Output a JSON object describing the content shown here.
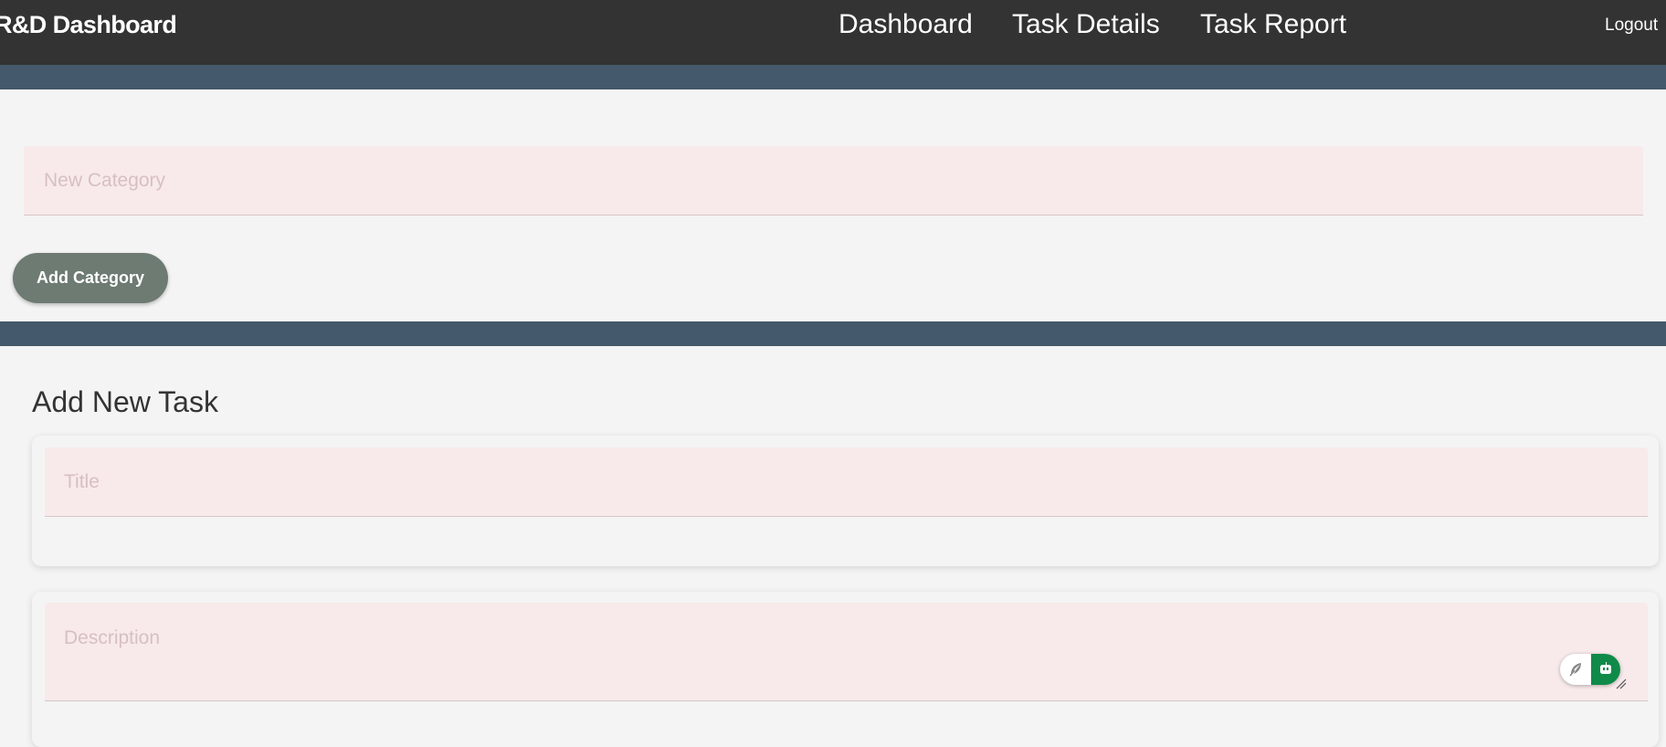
{
  "header": {
    "brand": "R&D Dashboard",
    "nav": {
      "dashboard": "Dashboard",
      "task_details": "Task Details",
      "task_report": "Task Report"
    },
    "logout": "Logout"
  },
  "category": {
    "placeholder": "New Category",
    "value": "",
    "add_button": "Add Category"
  },
  "task_form": {
    "heading": "Add New Task",
    "title_placeholder": "Title",
    "title_value": "",
    "description_placeholder": "Description",
    "description_value": ""
  },
  "extension": {
    "left_icon": "feather-icon",
    "right_icon": "robot-icon"
  },
  "colors": {
    "topbar": "#333333",
    "band": "#44596b",
    "field_bg": "#f8eaea",
    "button": "#6d7b73",
    "extension_green": "#0f8a48"
  }
}
